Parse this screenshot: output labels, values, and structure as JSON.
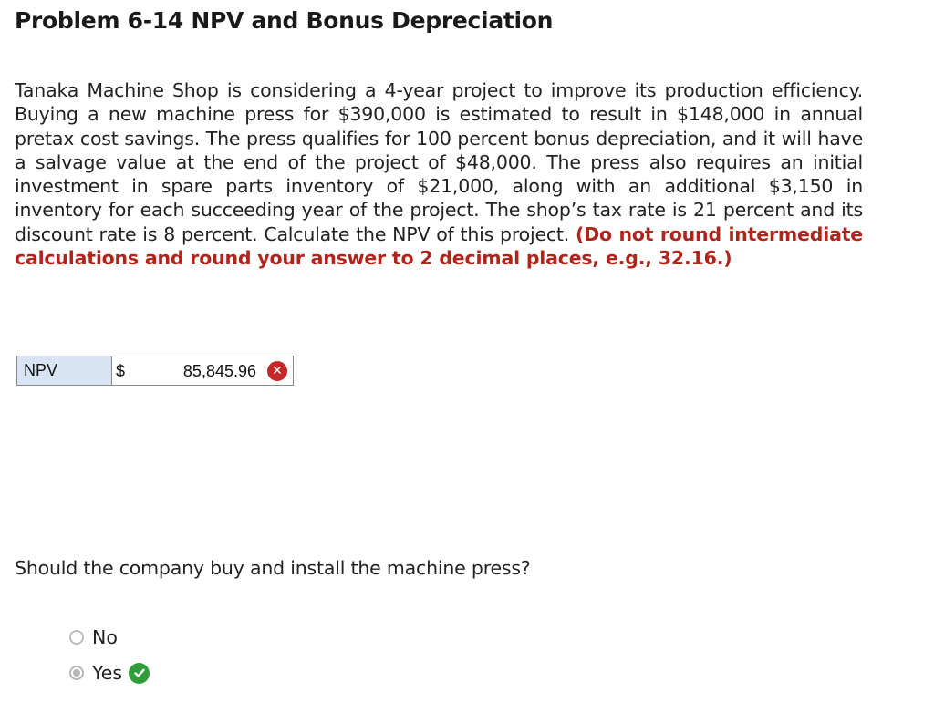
{
  "title": "Problem 6-14 NPV and Bonus Depreciation",
  "problem": {
    "body": "Tanaka Machine Shop is considering a 4-year project to improve its production efficiency. Buying a new machine press for $390,000 is estimated to result in $148,000 in annual pretax cost savings. The press qualifies for 100 percent bonus depreciation, and it will have a salvage value at the end of the project of $48,000. The press also requires an initial investment in spare parts inventory of $21,000, along with an additional $3,150 in inventory for each succeeding year of the project. The shop’s tax rate is 21 percent and its discount rate is 8 percent. Calculate the NPV of this project.",
    "instruction": "(Do not round intermediate calculations and round your answer to 2 decimal places, e.g., 32.16.)"
  },
  "answer_table": {
    "label": "NPV",
    "currency": "$",
    "value": "85,845.96",
    "status_icon": "x-icon",
    "status": "incorrect"
  },
  "question": {
    "text": "Should the company buy and install the machine press?",
    "options": [
      {
        "label": "No",
        "selected": false
      },
      {
        "label": "Yes",
        "selected": true,
        "status_icon": "check-icon",
        "status": "correct"
      }
    ]
  },
  "colors": {
    "instruction": "#b0241b",
    "label_cell_bg": "#d8e3f3",
    "incorrect": "#c62828",
    "correct": "#2e9d3a"
  }
}
